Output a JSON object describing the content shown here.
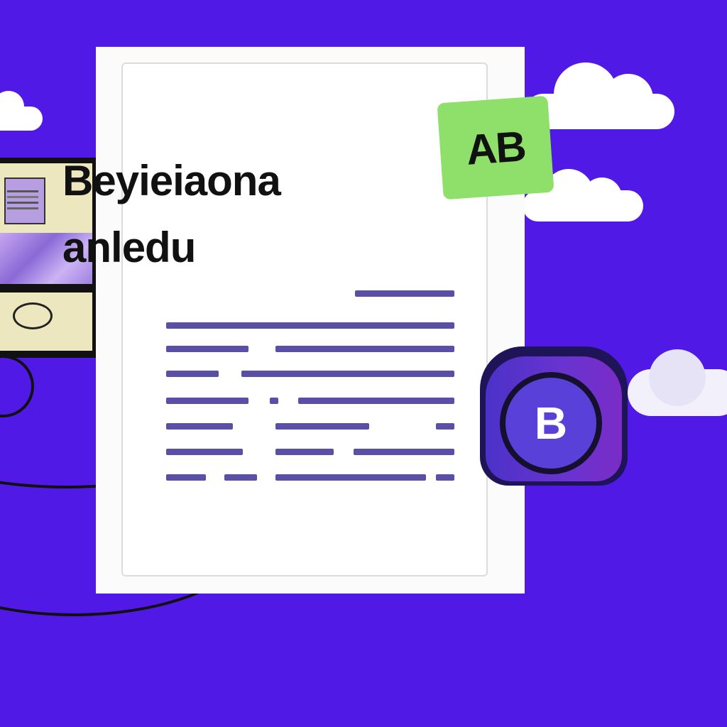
{
  "document": {
    "title": "Beyieiaona",
    "subtitle": "anledu"
  },
  "tag": {
    "label": "AB"
  },
  "badge": {
    "label": "B"
  },
  "colors": {
    "background": "#5119e6",
    "paper": "#ffffff",
    "text_lines": "#5a4fa6",
    "tag": "#8fe06a",
    "badge": "#5840d8"
  },
  "icons": [
    "cloud-icon",
    "monitor-icon",
    "badge-icon"
  ]
}
